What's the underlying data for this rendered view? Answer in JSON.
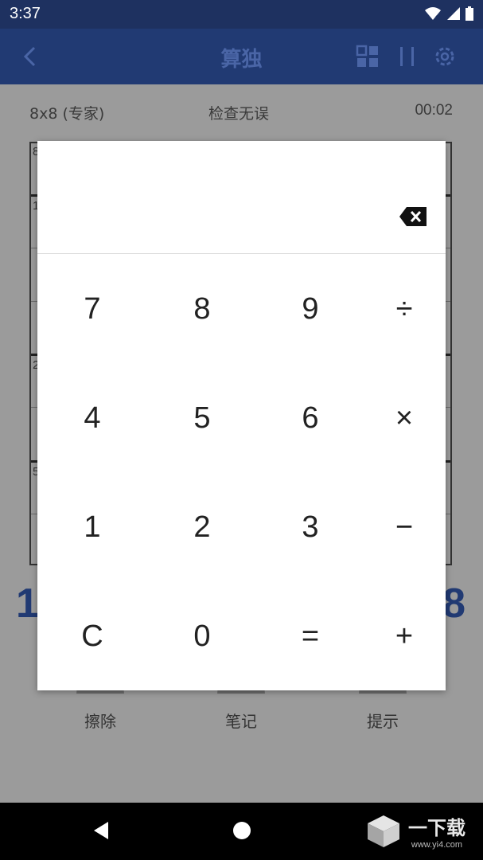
{
  "status_bar": {
    "time": "3:37"
  },
  "app_bar": {
    "title": "算独"
  },
  "game_info": {
    "size_label": "8x8 (专家)",
    "status_text": "检查无误",
    "timer": "00:02"
  },
  "board": {
    "cage_labels": [
      "8",
      "1",
      "2",
      "5"
    ]
  },
  "big_numbers": {
    "left": "1",
    "right": "8"
  },
  "tools": {
    "erase": "擦除",
    "notes": "笔记",
    "hint": "提示"
  },
  "keypad": {
    "display_value": "",
    "keys": [
      [
        "7",
        "8",
        "9",
        "÷"
      ],
      [
        "4",
        "5",
        "6",
        "×"
      ],
      [
        "1",
        "2",
        "3",
        "−"
      ],
      [
        "C",
        "0",
        "=",
        "+"
      ]
    ]
  },
  "watermark": {
    "name": "一下载",
    "url": "www.yi4.com"
  },
  "colors": {
    "app_bar": "#213a73",
    "status_bar": "#1e3160",
    "accent_number": "#213a73",
    "dialog": "#ffffff"
  }
}
